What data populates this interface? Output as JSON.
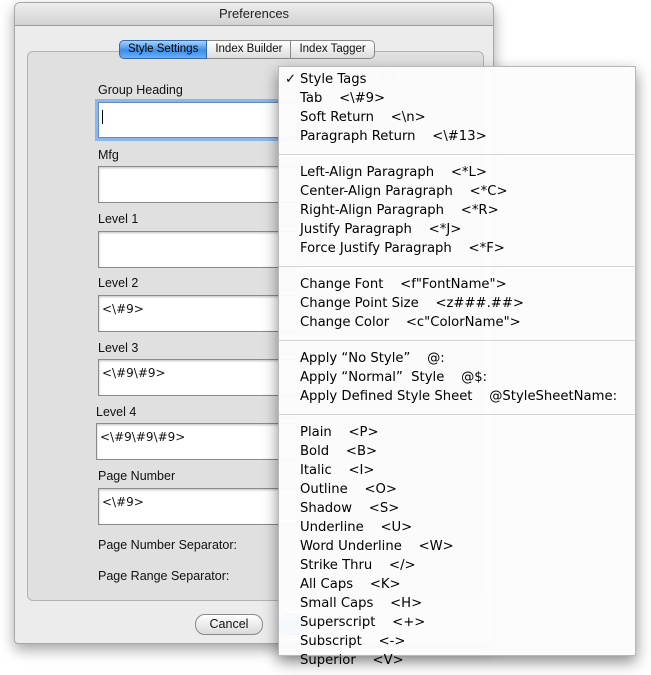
{
  "window": {
    "title": "Preferences"
  },
  "tabs": [
    {
      "label": "Style Settings",
      "active": true
    },
    {
      "label": "Index Builder",
      "active": false
    },
    {
      "label": "Index Tagger",
      "active": false
    }
  ],
  "fields": {
    "group_heading": {
      "label": "Group Heading",
      "value": ""
    },
    "mfg": {
      "label": "Mfg",
      "value": ""
    },
    "level1": {
      "label": "Level 1",
      "value": ""
    },
    "level2": {
      "label": "Level 2",
      "value": "<\\#9>"
    },
    "level3": {
      "label": "Level 3",
      "value": "<\\#9\\#9>"
    },
    "level4": {
      "label": "Level 4",
      "value": "<\\#9\\#9\\#9>"
    },
    "page_number": {
      "label": "Page Number",
      "value": "<\\#9>"
    },
    "page_number_separator": {
      "label": "Page Number Separator:"
    },
    "page_range_separator": {
      "label": "Page Range Separator:"
    }
  },
  "buttons": {
    "cancel": "Cancel"
  },
  "menu": {
    "groups": [
      [
        {
          "label": "Style Tags",
          "checked": true
        },
        {
          "label": "Tab    <\\#9>"
        },
        {
          "label": "Soft Return    <\\n>"
        },
        {
          "label": "Paragraph Return    <\\#13>"
        }
      ],
      [
        {
          "label": "Left-Align Paragraph    <*L>"
        },
        {
          "label": "Center-Align Paragraph    <*C>"
        },
        {
          "label": "Right-Align Paragraph    <*R>"
        },
        {
          "label": "Justify Paragraph    <*J>"
        },
        {
          "label": "Force Justify Paragraph    <*F>"
        }
      ],
      [
        {
          "label": "Change Font    <f\"FontName\">"
        },
        {
          "label": "Change Point Size    <z###.##>"
        },
        {
          "label": "Change Color    <c\"ColorName\">"
        }
      ],
      [
        {
          "label": "Apply “No Style”    @:"
        },
        {
          "label": "Apply “Normal”  Style    @$:"
        },
        {
          "label": "Apply Defined Style Sheet    @StyleSheetName:"
        }
      ],
      [
        {
          "label": "Plain    <P>"
        },
        {
          "label": "Bold    <B>"
        },
        {
          "label": "Italic    <I>"
        },
        {
          "label": "Outline    <O>"
        },
        {
          "label": "Shadow    <S>"
        },
        {
          "label": "Underline    <U>"
        },
        {
          "label": "Word Underline    <W>"
        },
        {
          "label": "Strike Thru    </>"
        },
        {
          "label": "All Caps    <K>"
        },
        {
          "label": "Small Caps    <H>"
        },
        {
          "label": "Superscript    <+>"
        },
        {
          "label": "Subscript    <->"
        },
        {
          "label": "Superior    <V>"
        }
      ]
    ]
  },
  "colors": {
    "accent": "#3c8ee6",
    "focus_ring": "#8db7ea",
    "window_bg": "#ececec"
  }
}
